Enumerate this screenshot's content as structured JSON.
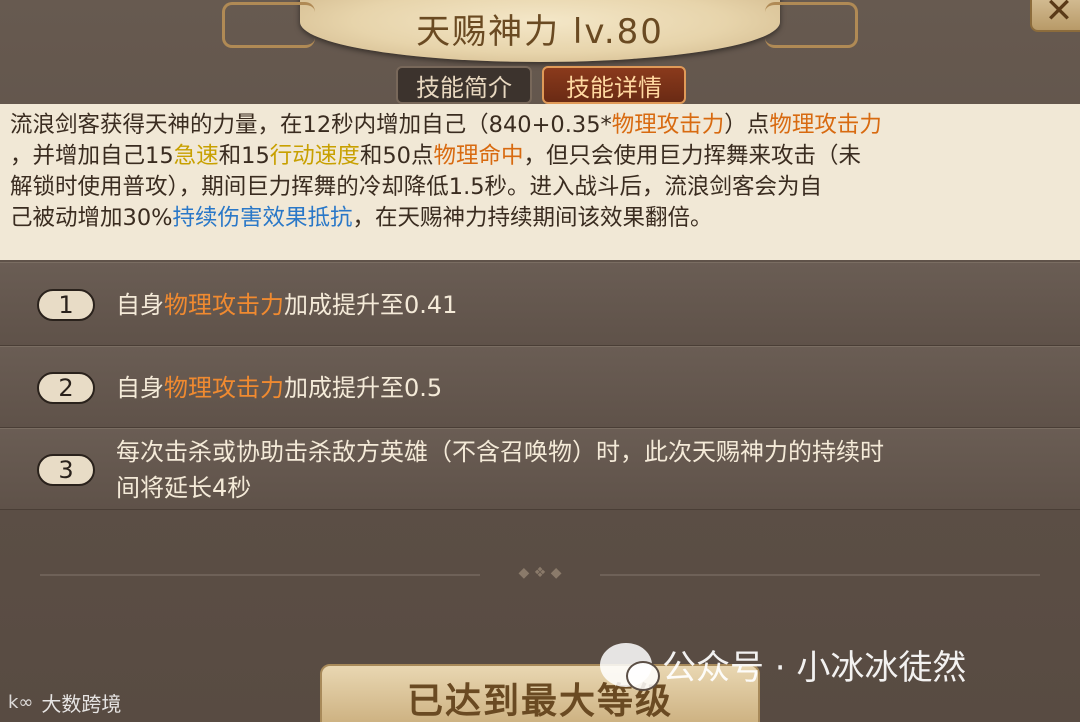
{
  "title": "天赐神力 lv.80",
  "tabs": {
    "brief": "技能简介",
    "detail": "技能详情"
  },
  "description": {
    "line1": {
      "a": "流浪剑客获得天神的力量，在12秒内增加自己（840+0.35*",
      "b": "物理攻击力",
      "c": "）点",
      "d": "物理攻击力"
    },
    "line2": {
      "a": "，并增加自己15",
      "b": "急速",
      "c": "和15",
      "d": "行动速度",
      "e": "和50点",
      "f": "物理命中",
      "g": "，但只会使用巨力挥舞来攻击（未"
    },
    "line3": "解锁时使用普攻），期间巨力挥舞的冷却降低1.5秒。进入战斗后，流浪剑客会为自",
    "line4": {
      "a": "己被动增加30%",
      "b": "持续伤害效果抵抗",
      "c": "，在天赐神力持续期间该效果翻倍。"
    }
  },
  "upgrades": [
    {
      "num": "1",
      "pre": "自身",
      "hl": "物理攻击力",
      "post": "加成提升至0.41"
    },
    {
      "num": "2",
      "pre": "自身",
      "hl": "物理攻击力",
      "post": "加成提升至0.5"
    },
    {
      "num": "3",
      "line1": "每次击杀或协助击杀敌方英雄（不含召唤物）时，此次天赐神力的持续时",
      "line2": "间将延长4秒"
    }
  ],
  "max_level_label": "已达到最大等级",
  "watermark": "公众号 · 小冰冰徒然",
  "corner_logo": {
    "mark": "k∞",
    "text": "大数跨境"
  },
  "close_icon": "close-x-icon",
  "colors": {
    "highlight_orange": "#d86a10",
    "highlight_yellow": "#c8a000",
    "highlight_blue": "#2a78c8"
  }
}
